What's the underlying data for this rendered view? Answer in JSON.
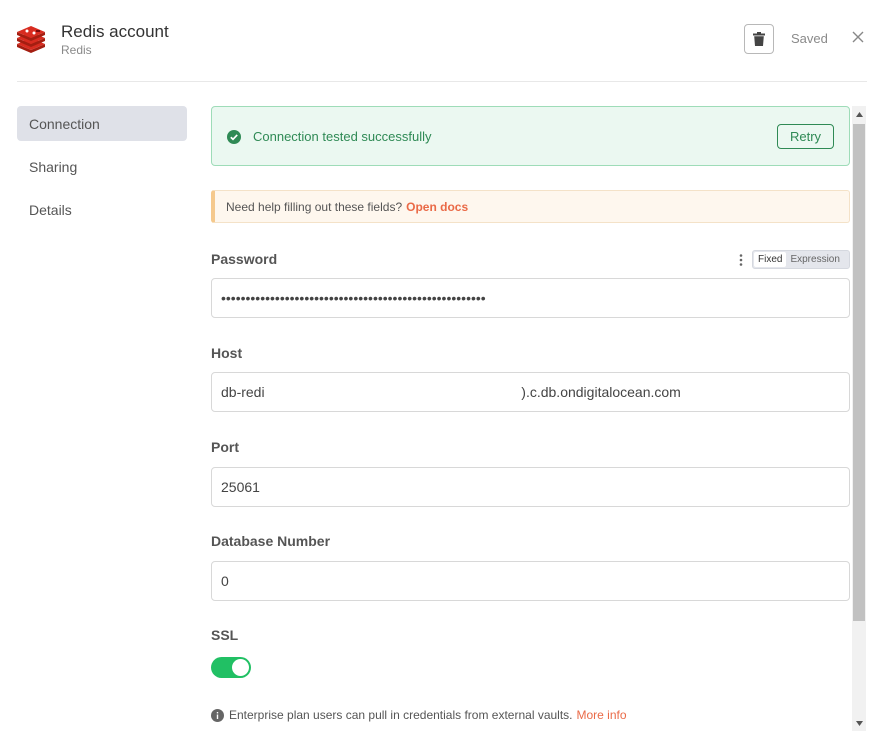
{
  "header": {
    "title": "Redis account",
    "subtitle": "Redis",
    "saved_label": "Saved",
    "icons": {
      "logo": "redis-logo-icon",
      "delete": "trash-icon",
      "close": "close-icon"
    }
  },
  "sidebar": {
    "items": [
      {
        "label": "Connection",
        "active": true
      },
      {
        "label": "Sharing",
        "active": false
      },
      {
        "label": "Details",
        "active": false
      }
    ]
  },
  "banner": {
    "message": "Connection tested successfully",
    "retry_label": "Retry",
    "icon": "check-circle-icon"
  },
  "docs_notice": {
    "text": "Need help filling out these fields?",
    "link": "Open docs"
  },
  "fields": {
    "password": {
      "label": "Password",
      "value": "••••••••••••••••••••••••••••••••••••••••••••••••••••••",
      "mode_fixed": "Fixed",
      "mode_expression": "Expression"
    },
    "host": {
      "label": "Host",
      "value": "db-redi                                                                  ).c.db.ondigitalocean.com"
    },
    "port": {
      "label": "Port",
      "value": "25061"
    },
    "database_number": {
      "label": "Database Number",
      "value": "0"
    },
    "ssl": {
      "label": "SSL",
      "enabled": true
    }
  },
  "enterprise_note": {
    "text": "Enterprise plan users can pull in credentials from external vaults.",
    "link": "More info"
  },
  "colors": {
    "success": "#2f8a55",
    "toggle_on": "#21c064",
    "link": "#ea6a47",
    "redis_red": "#d82c20"
  }
}
